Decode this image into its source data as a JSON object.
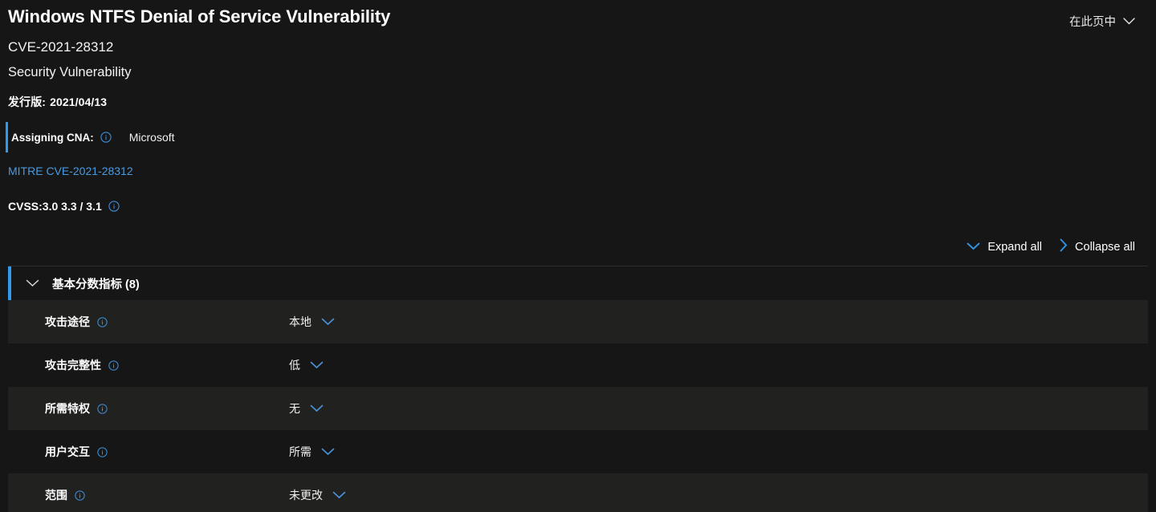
{
  "header": {
    "title": "Windows NTFS Denial of Service Vulnerability",
    "cve_id": "CVE-2021-28312",
    "cve_type": "Security Vulnerability",
    "release_label": "发行版:",
    "release_date": "2021/04/13",
    "onpage_nav_label": "在此页中"
  },
  "cna": {
    "label": "Assigning CNA:",
    "value": "Microsoft",
    "accent_color": "#2f9bf0"
  },
  "mitre": {
    "link_text": "MITRE CVE-2021-28312",
    "link_color": "#4a9ae0"
  },
  "cvss": {
    "text": "CVSS:3.0 3.3 / 3.1"
  },
  "controls": {
    "expand_all": "Expand all",
    "collapse_all": "Collapse all"
  },
  "section": {
    "title": "基本分数指标 (8)",
    "metrics": [
      {
        "label": "攻击途径",
        "value": "本地"
      },
      {
        "label": "攻击完整性",
        "value": "低"
      },
      {
        "label": "所需特权",
        "value": "无"
      },
      {
        "label": "用户交互",
        "value": "所需"
      },
      {
        "label": "范围",
        "value": "未更改"
      }
    ]
  },
  "theme": {
    "background": "#161616",
    "row_light": "#212120",
    "row_dark": "#161616",
    "accent_blue": "#2f9bf0",
    "link_blue": "#4a9ae0"
  }
}
